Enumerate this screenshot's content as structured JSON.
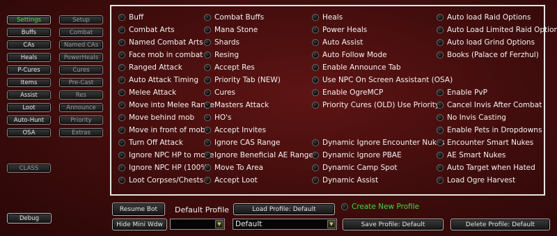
{
  "sidebar": {
    "left": [
      "Settings",
      "Buffs",
      "CAs",
      "Heals",
      "P-Cures",
      "Items",
      "Assist",
      "Loot",
      "Auto-Hunt",
      "OSA"
    ],
    "right": [
      "Setup",
      "Combat",
      "Named CAs",
      "PowerHeals",
      "Cures",
      "Pre-Cast",
      "Res",
      "Announce",
      "Priority",
      "Extras"
    ],
    "class_button": "CLASS",
    "debug_button": "Debug"
  },
  "options": {
    "col1": [
      "Buff",
      "Combat Arts",
      "Named Combat Arts",
      "Face mob in combat",
      "Ranged Attack",
      "Auto Attack Timing",
      "Melee Attack",
      "Move into Melee Range",
      "Move behind mob",
      "Move in front of mob",
      "Turn Off Attack",
      "Ignore NPC HP to move",
      "Ignore NPC HP (100%)",
      "Loot Corpses/Chests"
    ],
    "col2": [
      "Combat Buffs",
      "Mana Stone",
      "Shards",
      "Resing",
      "Accept Res",
      "Priority Tab (NEW)",
      "Cures",
      "Masters Attack",
      "HO's",
      "Accept Invites",
      "Ignore CAS Range",
      "Ignore Beneficial AE Range",
      "Move To Area",
      "Accept Loot"
    ],
    "col3": [
      "Heals",
      "Power Heals",
      "Auto Assist",
      "Auto Follow Mode",
      "Enable Announce Tab",
      "Use NPC On Screen Assistant (OSA)",
      "Enable OgreMCP",
      "Priority Cures (OLD) Use Priority",
      "",
      "",
      "Dynamic Ignore Encounter Nukes",
      "Dynamic Ignore PBAE",
      "Dynamic Camp Spot",
      "Dynamic Assist"
    ],
    "col4": [
      "Auto load Raid Options",
      "Auto Load Limited Raid Options",
      "Auto load Grind Options",
      "Books (Palace of Ferzhul)",
      "",
      "",
      "Enable PvP",
      "Cancel Invis After Combat",
      "No Invis Casting",
      "Enable Pets in Dropdowns",
      "Encounter Smart Nukes",
      "AE Smart Nukes",
      "Auto Target when Hated",
      "Load Ogre Harvest"
    ]
  },
  "bottom": {
    "resume_bot": "Resume Bot",
    "default_profile_label": "Default Profile",
    "load_profile": "Load Profile: Default",
    "create_new_profile": "Create New Profile",
    "hide_mini_wdw": "Hide Mini Wdw",
    "profile_combo_value": "",
    "profile_select_value": "Default",
    "save_profile": "Save Profile: Default",
    "delete_profile": "Delete Profile: Default"
  },
  "colors": {
    "active_tab": "#4fd94f",
    "create_profile_text": "#3fdc3f",
    "background": "#4a0f0f"
  }
}
